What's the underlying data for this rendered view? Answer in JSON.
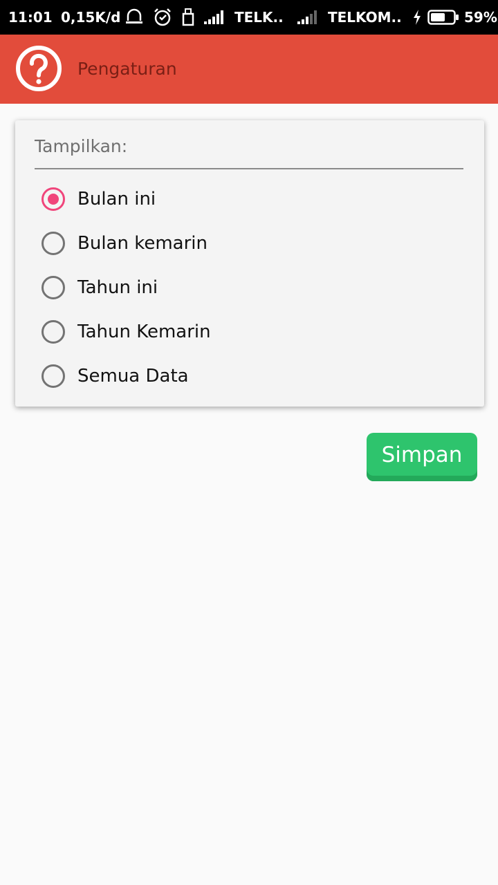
{
  "status_bar": {
    "time": "11:01",
    "speed": "0,15K/d",
    "carrier_1": "TELK..",
    "carrier_2": "TELKOM..",
    "battery": "59%",
    "icons": [
      "notification-bell-icon",
      "alarm-icon",
      "usb-icon",
      "signal-icon",
      "signal-icon",
      "charging-icon",
      "battery-icon"
    ]
  },
  "app_bar": {
    "title": "Pengaturan",
    "icon": "help-icon",
    "color": "#e24c3b"
  },
  "settings": {
    "label": "Tampilkan:",
    "options": [
      {
        "label": "Bulan ini",
        "checked": true
      },
      {
        "label": "Bulan kemarin",
        "checked": false
      },
      {
        "label": "Tahun ini",
        "checked": false
      },
      {
        "label": "Tahun Kemarin",
        "checked": false
      },
      {
        "label": "Semua Data",
        "checked": false
      }
    ],
    "accent_color": "#f0457b"
  },
  "save_button": {
    "label": "Simpan",
    "color": "#2ec46d"
  }
}
